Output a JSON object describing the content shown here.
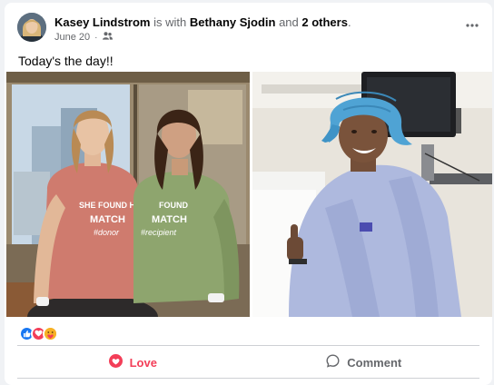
{
  "post": {
    "author": "Kasey Lindstrom",
    "with_text": " is with ",
    "tagged": "Bethany Sjodin",
    "and_text": " and ",
    "others": "2 others",
    "period": ".",
    "date": "June 20",
    "dot": "·",
    "audience_icon": "friends-icon",
    "more_label": "•••",
    "text": "Today's the day!!"
  },
  "photos": {
    "left": {
      "shirt_text_1": "SHE FOUND HER",
      "shirt_text_2": "MATCH",
      "shirt_text_3": "#donor",
      "shirt_text_4": "FOUND",
      "shirt_text_5": "MATCH",
      "shirt_text_6": "#recipient"
    }
  },
  "reactions": {
    "icons": [
      "like-icon",
      "love-icon",
      "care-icon"
    ]
  },
  "actions": {
    "love_label": "Love",
    "comment_label": "Comment"
  },
  "colors": {
    "love": "#f33e58",
    "like_blue": "#1877f2",
    "muted": "#65676b"
  }
}
